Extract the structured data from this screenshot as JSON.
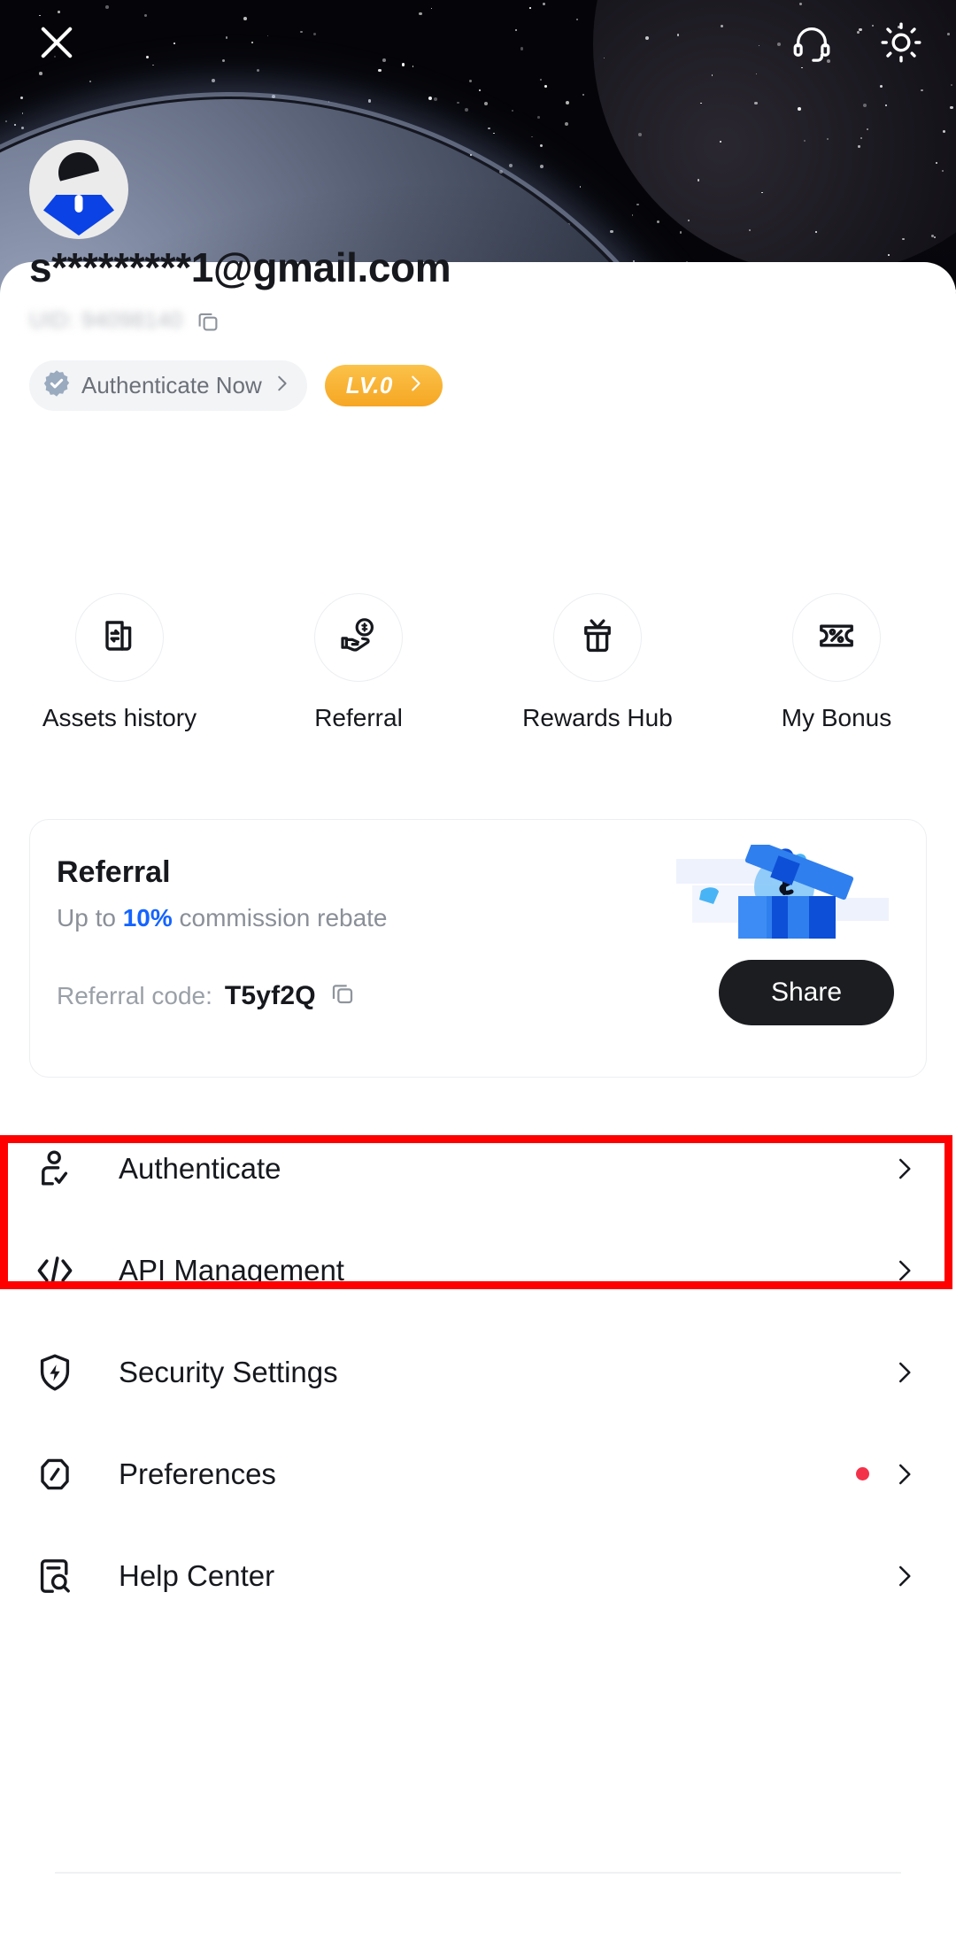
{
  "header": {
    "close_icon": "close-icon",
    "support_icon": "headset-icon",
    "theme_icon": "sun-icon"
  },
  "profile": {
    "avatar": "user-avatar",
    "email": "s*********1@gmail.com",
    "uid_label": "UID: 94098140",
    "copy_icon": "copy-icon",
    "authenticate_badge": {
      "label": "Authenticate Now",
      "icon": "verified-badge-icon",
      "chevron": "chevron-right-icon"
    },
    "level_badge": {
      "label": "LV.0",
      "chevron": "chevron-right-icon",
      "color": "#F6A623"
    }
  },
  "quick_actions": [
    {
      "label": "Assets history",
      "icon": "assets-history-icon"
    },
    {
      "label": "Referral",
      "icon": "hand-coin-icon"
    },
    {
      "label": "Rewards Hub",
      "icon": "gift-box-icon"
    },
    {
      "label": "My Bonus",
      "icon": "percent-ticket-icon"
    }
  ],
  "referral_card": {
    "title": "Referral",
    "subtitle_prefix": "Up to ",
    "subtitle_highlight": "10%",
    "subtitle_suffix": " commission rebate",
    "highlight_color": "#1464ff",
    "code_label": "Referral code:",
    "code_value": "T5yf2Q",
    "copy_icon": "copy-icon",
    "share_label": "Share",
    "illustration": "gift-money-illustration"
  },
  "menu": [
    {
      "label": "Authenticate",
      "icon": "user-check-icon",
      "badge_dot": false,
      "highlighted": true
    },
    {
      "label": "API Management",
      "icon": "code-brackets-icon",
      "badge_dot": false,
      "highlighted": false
    },
    {
      "label": "Security Settings",
      "icon": "shield-bolt-icon",
      "badge_dot": false,
      "highlighted": false
    },
    {
      "label": "Preferences",
      "icon": "sliders-hex-icon",
      "badge_dot": true,
      "highlighted": false
    },
    {
      "label": "Help Center",
      "icon": "help-doc-icon",
      "badge_dot": false,
      "highlighted": false
    }
  ],
  "highlight": {
    "color": "#ff0000",
    "target": "Authenticate"
  }
}
